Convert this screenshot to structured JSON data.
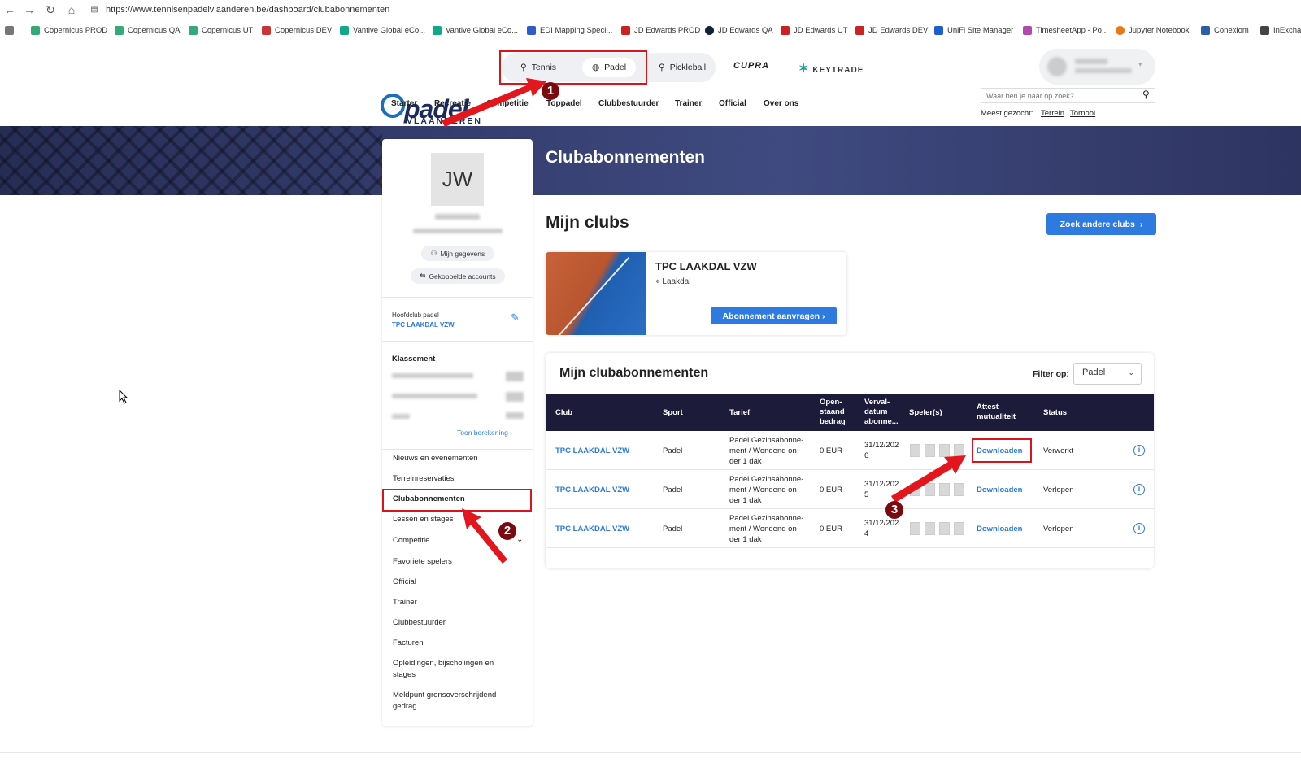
{
  "browser": {
    "url": "https://www.tennisenpadelvlaanderen.be/dashboard/clubabonnementen",
    "bookmarks": [
      "Copernicus PROD",
      "Copernicus QA",
      "Copernicus UT",
      "Copernicus DEV",
      "Vantive Global eCo...",
      "Vantive Global eCo...",
      "EDI Mapping Speci...",
      "JD Edwards PROD",
      "JD Edwards QA",
      "JD Edwards UT",
      "JD Edwards DEV",
      "UniFi Site Manager",
      "TimesheetApp - Po...",
      "Jupyter Notebook",
      "Conexiom",
      "InExchan"
    ]
  },
  "header": {
    "logo_main": "padel",
    "logo_sub": "VLAANDEREN",
    "sports": [
      "Tennis",
      "Padel",
      "Pickleball"
    ],
    "sponsors": [
      "CUPRA",
      "KEYTRADE"
    ],
    "nav": [
      "Starter",
      "Recreatie",
      "Competitie",
      "Toppadel",
      "Clubbestuurder",
      "Trainer",
      "Official",
      "Over ons"
    ],
    "search_placeholder": "Waar ben je naar op zoek?",
    "most_searched_label": "Meest gezocht:",
    "most_searched": [
      "Terrein",
      "Tornooi"
    ]
  },
  "page": {
    "title": "Clubabonnementen"
  },
  "sidebar": {
    "initials": "JW",
    "btn_details": "Mijn gegevens",
    "btn_linked": "Gekoppelde accounts",
    "main_club_label": "Hoofdclub padel",
    "main_club": "TPC LAAKDAL VZW",
    "ranking_title": "Klassement",
    "show_calc": "Toon berekening",
    "menu": [
      "Nieuws en evenementen",
      "Terreinreservaties",
      "Clubabonnementen",
      "Lessen en stages",
      "Competitie",
      "Favoriete spelers",
      "Official",
      "Trainer",
      "Clubbestuurder",
      "Facturen",
      "Opleidingen, bijscholingen en stages",
      "Meldpunt grensoverschrijdend gedrag"
    ]
  },
  "clubs": {
    "title": "Mijn clubs",
    "search_btn": "Zoek andere clubs",
    "club_name": "TPC LAAKDAL VZW",
    "club_location": "Laakdal",
    "request_btn": "Abonnement aanvragen"
  },
  "subscriptions": {
    "title": "Mijn clubabonnementen",
    "filter_label": "Filter op:",
    "filter_value": "Padel",
    "columns": [
      "Club",
      "Sport",
      "Tarief",
      "Open-\nstaand\nbedrag",
      "Verval-\ndatum\nabonne...",
      "Speler(s)",
      "Attest\nmutualiteit",
      "Status"
    ],
    "rows": [
      {
        "club": "TPC LAAKDAL VZW",
        "sport": "Padel",
        "tarief": "Padel Gezinsabonne-\nment / Wondend on-\nder 1 dak",
        "bedrag": "0 EUR",
        "verval": "31/12/202\n6",
        "attest": "Downloaden",
        "status": "Verwerkt"
      },
      {
        "club": "TPC LAAKDAL VZW",
        "sport": "Padel",
        "tarief": "Padel Gezinsabonne-\nment / Wondend on-\nder 1 dak",
        "bedrag": "0 EUR",
        "verval": "31/12/202\n5",
        "attest": "Downloaden",
        "status": "Verlopen"
      },
      {
        "club": "TPC LAAKDAL VZW",
        "sport": "Padel",
        "tarief": "Padel Gezinsabonne-\nment / Wondend on-\nder 1 dak",
        "bedrag": "0 EUR",
        "verval": "31/12/202\n4",
        "attest": "Downloaden",
        "status": "Verlopen"
      }
    ]
  },
  "annotations": {
    "step1": "1",
    "step2": "2",
    "step3": "3",
    "color": "#d9141c"
  }
}
